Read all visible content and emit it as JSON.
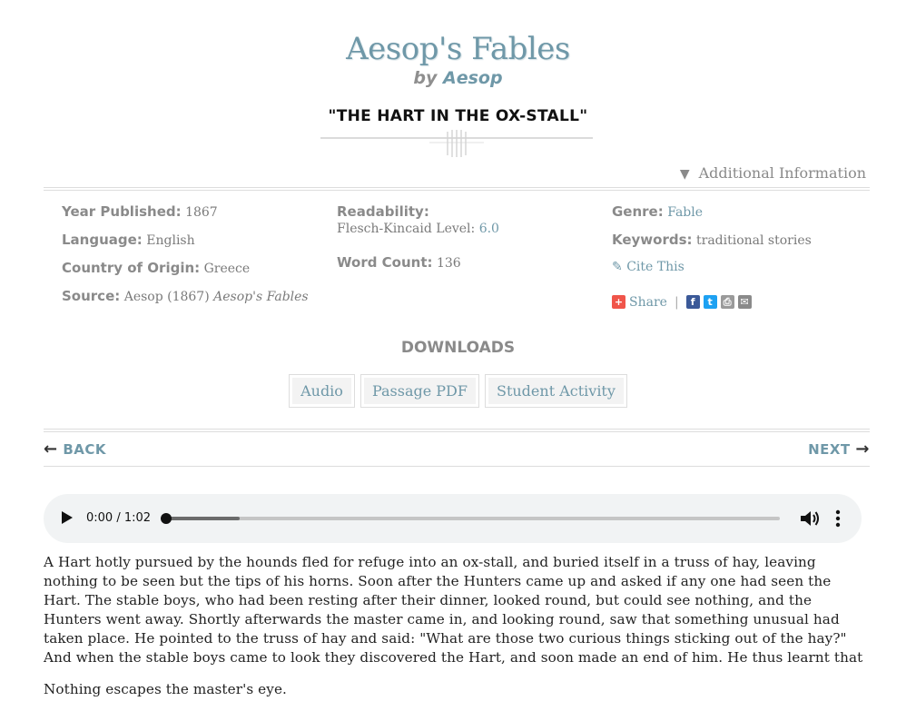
{
  "header": {
    "book_title": "Aesop's Fables",
    "by": "by",
    "author": "Aesop",
    "story_title": "\"THE HART IN THE OX-STALL\""
  },
  "additional_info": {
    "label": "Additional Information",
    "icon": "triangle-down-icon"
  },
  "meta": {
    "year_label": "Year Published:",
    "year": "1867",
    "language_label": "Language:",
    "language": "English",
    "country_label": "Country of Origin:",
    "country": "Greece",
    "source_label": "Source:",
    "source": "Aesop (1867)",
    "source_title": "Aesop's Fables",
    "readability_label": "Readability:",
    "fk_label": "Flesch-Kincaid Level:",
    "fk_value": "6.0",
    "word_count_label": "Word Count:",
    "word_count": "136",
    "genre_label": "Genre:",
    "genre": "Fable",
    "keywords_label": "Keywords:",
    "keywords": "traditional stories",
    "cite_label": "Cite This",
    "share_label": "Share"
  },
  "downloads": {
    "heading": "DOWNLOADS",
    "buttons": [
      "Audio",
      "Passage PDF",
      "Student Activity"
    ]
  },
  "nav": {
    "back": "BACK",
    "next": "NEXT"
  },
  "audio": {
    "time": "0:00 / 1:02",
    "progress": 0,
    "buffered": 0.12
  },
  "passage": {
    "p1": "A Hart hotly pursued by the hounds fled for refuge into an ox-stall, and buried itself in a truss of hay, leaving nothing to be seen but the tips of his horns. Soon after the Hunters came up and asked if any one had seen the Hart. The stable boys, who had been resting after their dinner, looked round, but could see nothing, and the Hunters went away. Shortly afterwards the master came in, and looking round, saw that something unusual had taken place. He pointed to the truss of hay and said: \"What are those two curious things sticking out of the hay?\" And when the stable boys came to look they discovered the Hart, and soon made an end of him. He thus learnt that",
    "p2": "Nothing escapes the master's eye."
  },
  "colors": {
    "accent": "#6f98a8",
    "muted": "#8a8a8a"
  }
}
